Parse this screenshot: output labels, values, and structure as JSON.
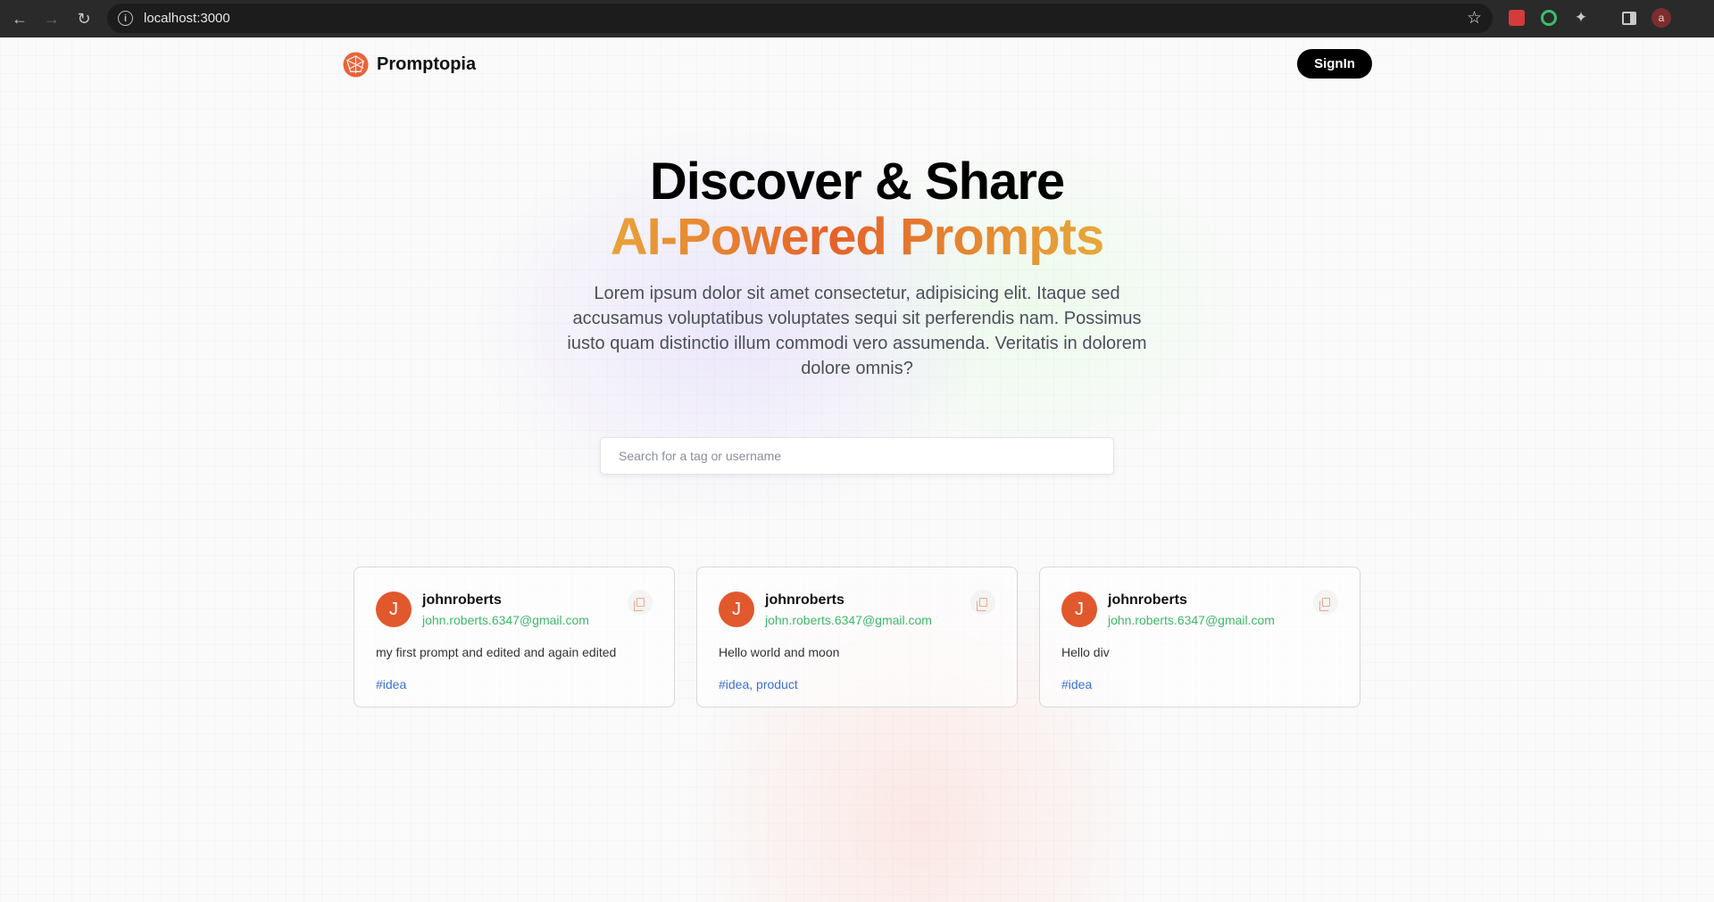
{
  "browser": {
    "url": "localhost:3000",
    "profile_initial": "a"
  },
  "header": {
    "logo_text": "Promptopia",
    "signin_label": "SignIn"
  },
  "hero": {
    "line1": "Discover & Share",
    "line2": "AI-Powered Prompts",
    "description": "Lorem ipsum dolor sit amet consectetur, adipisicing elit. Itaque sed accusamus voluptatibus voluptates sequi sit perferendis nam. Possimus iusto quam distinctio illum commodi vero assumenda. Veritatis in dolorem dolore omnis?"
  },
  "search": {
    "placeholder": "Search for a tag or username",
    "value": ""
  },
  "prompts": [
    {
      "avatar_initial": "J",
      "username": "johnroberts",
      "email": "john.roberts.6347@gmail.com",
      "text": "my first prompt and edited and again edited",
      "tags": "#idea"
    },
    {
      "avatar_initial": "J",
      "username": "johnroberts",
      "email": "john.roberts.6347@gmail.com",
      "text": "Hello world and moon",
      "tags": "#idea, product"
    },
    {
      "avatar_initial": "J",
      "username": "johnroberts",
      "email": "john.roberts.6347@gmail.com",
      "text": "Hello div",
      "tags": "#idea"
    }
  ],
  "colors": {
    "accent_orange": "#e1582c",
    "email_green": "#3fb86a",
    "tag_blue": "#3b6fd1",
    "button_black": "#000000"
  }
}
